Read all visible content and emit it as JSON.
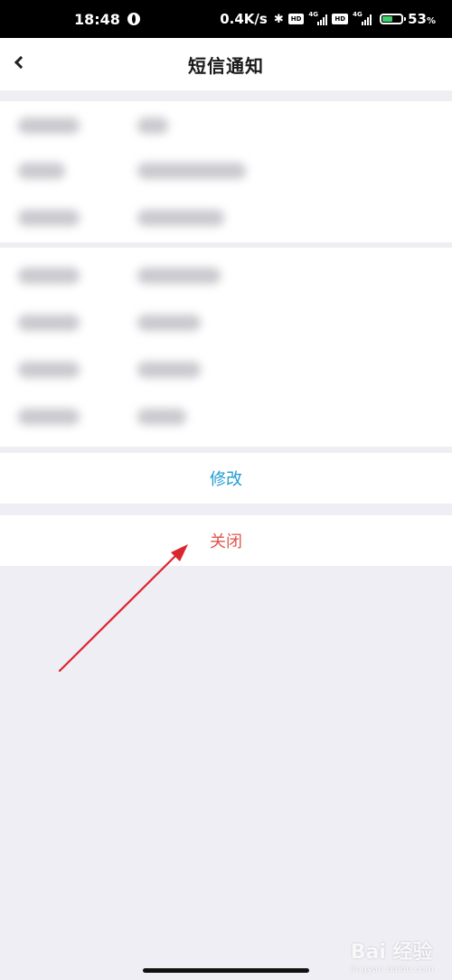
{
  "status_bar": {
    "time": "18:48",
    "net_speed": "0.4K/s",
    "hd_label": "HD",
    "network_label": "4G",
    "battery_percent": "53",
    "battery_unit": "%",
    "battery_level": 0.53
  },
  "header": {
    "title": "短信通知"
  },
  "info_groups": [
    {
      "rows": [
        {
          "label": "",
          "value": ""
        },
        {
          "label": "",
          "value": ""
        },
        {
          "label": "",
          "value": ""
        }
      ]
    },
    {
      "rows": [
        {
          "label": "",
          "value": ""
        },
        {
          "label": "",
          "value": ""
        },
        {
          "label": "",
          "value": ""
        },
        {
          "label": "",
          "value": ""
        }
      ]
    }
  ],
  "actions": {
    "edit_label": "修改",
    "close_label": "关闭"
  },
  "watermark": {
    "text": "Bai 经验",
    "sub": "jingyan.baidu.com"
  },
  "colors": {
    "accent_blue": "#1f9bd4",
    "close_red": "#e2544b",
    "annotation_arrow": "#d9262c",
    "background": "#efeef4"
  }
}
